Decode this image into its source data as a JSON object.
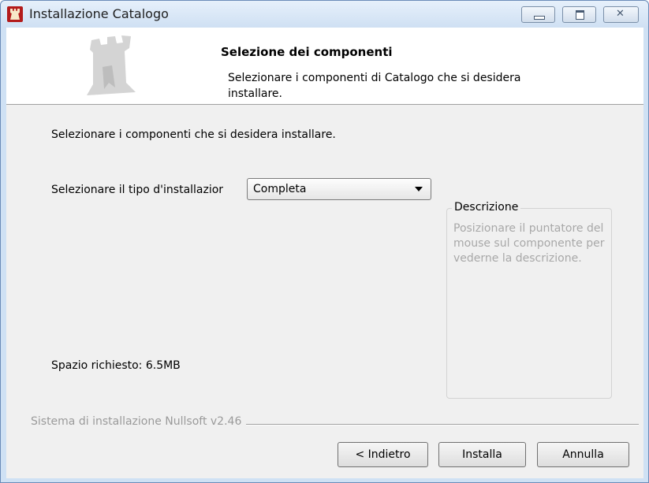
{
  "window": {
    "title": "Installazione Catalogo",
    "icon": "castle-tower-icon"
  },
  "header": {
    "title": "Selezione dei componenti",
    "subtitle": "Selezionare i componenti di Catalogo che si desidera installare.",
    "logo": "castle-tower-watermark"
  },
  "body": {
    "intro": "Selezionare i componenti che si desidera installare.",
    "type_label": "Selezionare il tipo d'installazior",
    "type_value": "Completa",
    "description_legend": "Descrizione",
    "description_text": "Posizionare il puntatore del mouse sul componente per vederne la descrizione.",
    "space_required": "Spazio richiesto: 6.5MB"
  },
  "footer": {
    "branding": "Sistema di installazione Nullsoft v2.46",
    "back_label": "< Indietro",
    "install_label": "Installa",
    "cancel_label": "Annulla"
  },
  "colors": {
    "frame": "#cfe1f4",
    "client": "#f0f0f0",
    "disabled_text": "#a8a8a8"
  }
}
